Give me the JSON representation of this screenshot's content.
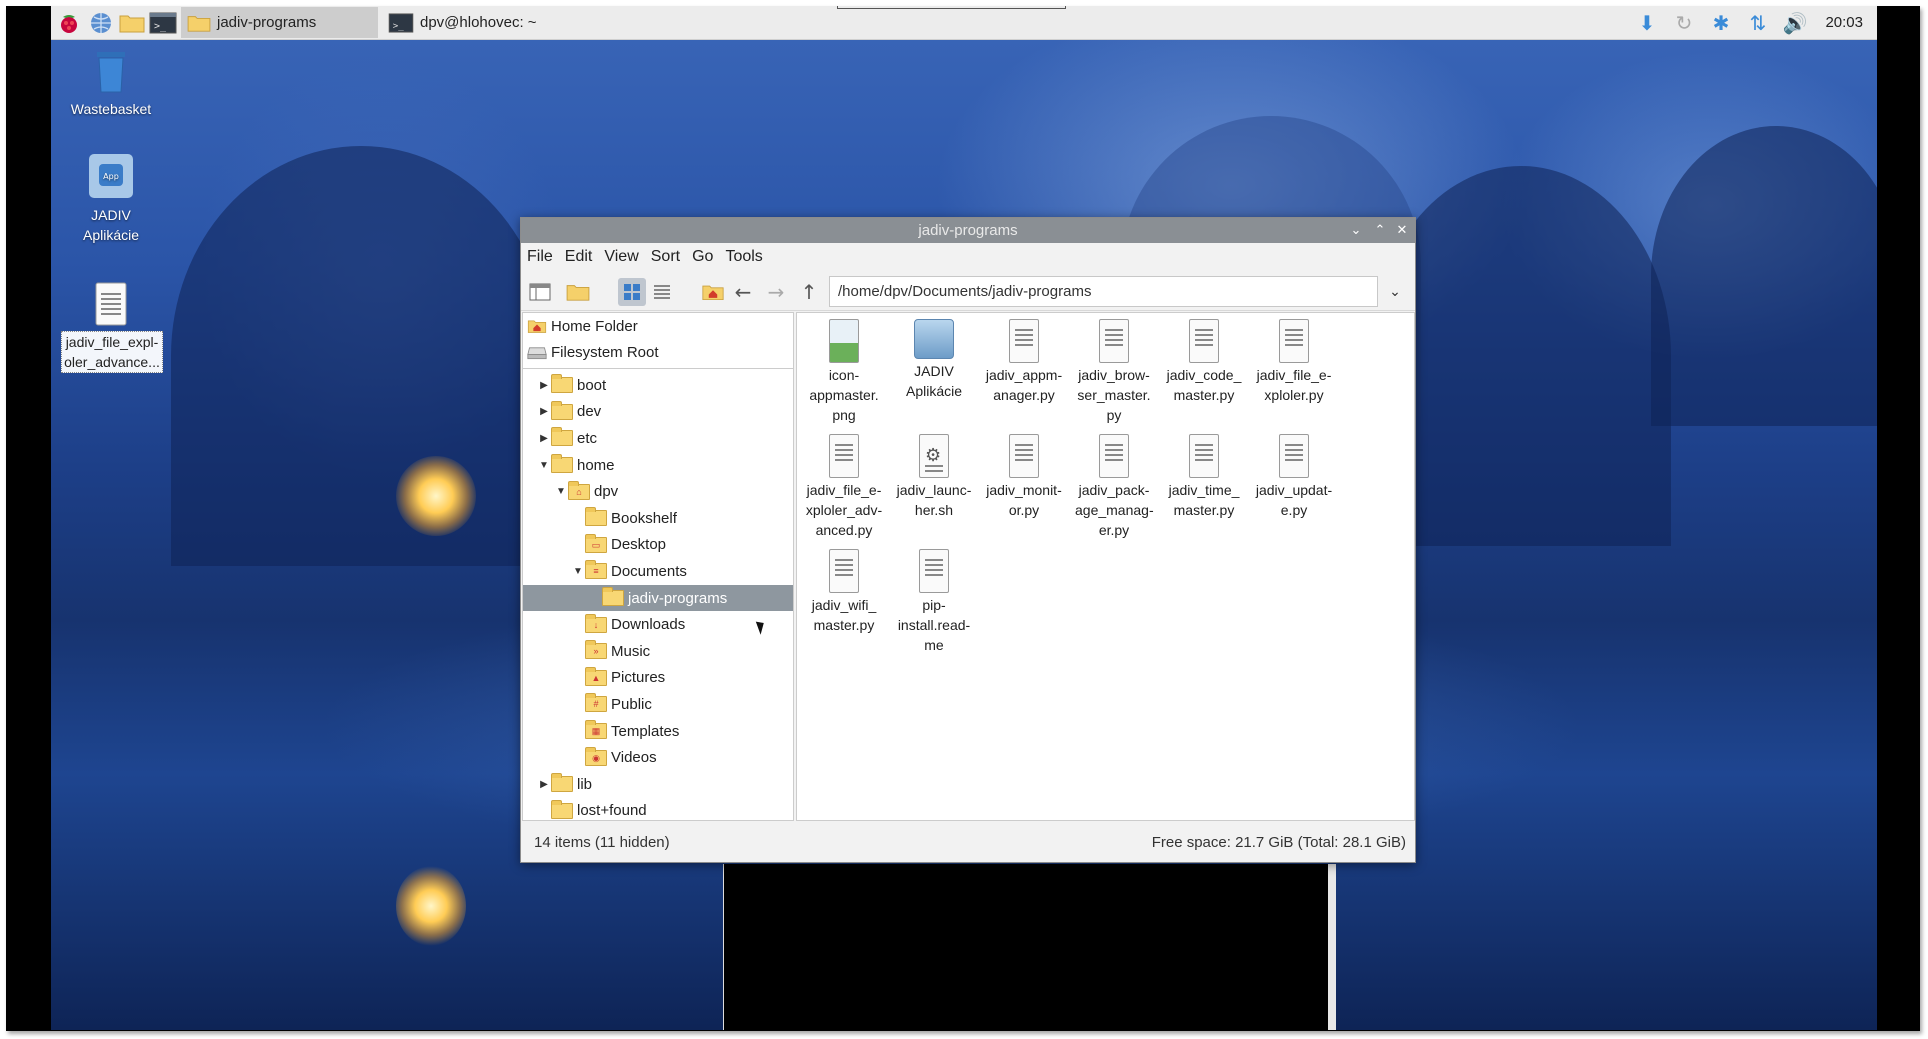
{
  "taskbar": {
    "tasks": [
      {
        "label": "jadiv-programs",
        "active": true
      },
      {
        "label": "dpv@hlohovec: ~",
        "active": false
      }
    ],
    "clock": "20:03",
    "launchers": [
      "raspberry-menu-icon",
      "web-browser-icon",
      "file-manager-icon",
      "terminal-icon"
    ],
    "tray": [
      "update-icon",
      "sync-icon",
      "bluetooth-icon",
      "network-icon",
      "volume-icon"
    ]
  },
  "desktop_icons": [
    {
      "label": "Wastebasket",
      "icon": "trash-icon"
    },
    {
      "label": "JADIV Aplikácie",
      "icon": "app-icon"
    },
    {
      "label": "jadiv_file_expl-oler_advance...",
      "icon": "text-file-icon"
    }
  ],
  "window": {
    "title": "jadiv-programs",
    "menu": [
      "File",
      "Edit",
      "View",
      "Sort",
      "Go",
      "Tools"
    ],
    "path": "/home/dpv/Documents/jadiv-programs",
    "places": [
      {
        "label": "Home Folder",
        "icon": "home-icon"
      },
      {
        "label": "Filesystem Root",
        "icon": "drive-icon"
      }
    ],
    "tree": [
      {
        "label": "boot",
        "indent": 1,
        "arrow": "right"
      },
      {
        "label": "dev",
        "indent": 1,
        "arrow": "right"
      },
      {
        "label": "etc",
        "indent": 1,
        "arrow": "right"
      },
      {
        "label": "home",
        "indent": 1,
        "arrow": "down"
      },
      {
        "label": "dpv",
        "indent": 2,
        "arrow": "down",
        "home": true
      },
      {
        "label": "Bookshelf",
        "indent": 3,
        "arrow": ""
      },
      {
        "label": "Desktop",
        "indent": 3,
        "arrow": ""
      },
      {
        "label": "Documents",
        "indent": 3,
        "arrow": "down"
      },
      {
        "label": "jadiv-programs",
        "indent": 4,
        "arrow": "",
        "selected": true
      },
      {
        "label": "Downloads",
        "indent": 3,
        "arrow": ""
      },
      {
        "label": "Music",
        "indent": 3,
        "arrow": ""
      },
      {
        "label": "Pictures",
        "indent": 3,
        "arrow": ""
      },
      {
        "label": "Public",
        "indent": 3,
        "arrow": ""
      },
      {
        "label": "Templates",
        "indent": 3,
        "arrow": ""
      },
      {
        "label": "Videos",
        "indent": 3,
        "arrow": ""
      },
      {
        "label": "lib",
        "indent": 1,
        "arrow": "right"
      },
      {
        "label": "lost+found",
        "indent": 1,
        "arrow": ""
      }
    ],
    "files": [
      {
        "l1": "icon-",
        "l2": "appmaster.",
        "l3": "png",
        "kind": "img"
      },
      {
        "l1": "JADIV",
        "l2": "Aplikácie",
        "l3": "",
        "kind": "app"
      },
      {
        "l1": "jadiv_appm-",
        "l2": "anager.py",
        "l3": "",
        "kind": "text"
      },
      {
        "l1": "jadiv_brow-",
        "l2": "ser_master.",
        "l3": "py",
        "kind": "text"
      },
      {
        "l1": "jadiv_code_",
        "l2": "master.py",
        "l3": "",
        "kind": "text"
      },
      {
        "l1": "jadiv_file_e-",
        "l2": "xploler.py",
        "l3": "",
        "kind": "text"
      },
      {
        "l1": "jadiv_file_e-",
        "l2": "xploler_adv-",
        "l3": "anced.py",
        "kind": "text"
      },
      {
        "l1": "jadiv_launc-",
        "l2": "her.sh",
        "l3": "",
        "kind": "gear"
      },
      {
        "l1": "jadiv_monit-",
        "l2": "or.py",
        "l3": "",
        "kind": "text"
      },
      {
        "l1": "jadiv_pack-",
        "l2": "age_manag-",
        "l3": "er.py",
        "kind": "text"
      },
      {
        "l1": "jadiv_time_",
        "l2": "master.py",
        "l3": "",
        "kind": "text"
      },
      {
        "l1": "jadiv_updat-",
        "l2": "e.py",
        "l3": "",
        "kind": "text"
      },
      {
        "l1": "jadiv_wifi_",
        "l2": "master.py",
        "l3": "",
        "kind": "text"
      },
      {
        "l1": "pip-",
        "l2": "install.read-",
        "l3": "me",
        "kind": "text"
      }
    ],
    "status_left": "14 items (11 hidden)",
    "status_right": "Free space: 21.7 GiB (Total: 28.1 GiB)"
  }
}
